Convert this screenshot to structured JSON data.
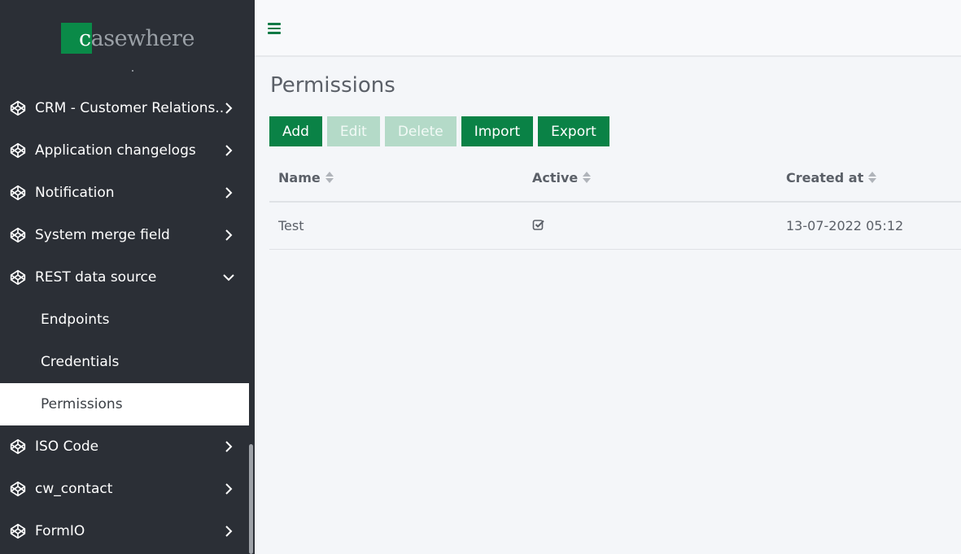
{
  "app": {
    "logo_text_c": "c",
    "logo_text_rest": "asewhere"
  },
  "sidebar": {
    "items": [
      {
        "label": "CRM - Customer Relations...",
        "icon": "codepen-icon",
        "chevron": "chevron-right"
      },
      {
        "label": "Application changelogs",
        "icon": "codepen-icon",
        "chevron": "chevron-right"
      },
      {
        "label": "Notification",
        "icon": "codepen-icon",
        "chevron": "chevron-right"
      },
      {
        "label": "System merge field",
        "icon": "codepen-icon",
        "chevron": "chevron-right"
      },
      {
        "label": "REST data source",
        "icon": "codepen-icon",
        "chevron": "chevron-down"
      },
      {
        "label": "ISO Code",
        "icon": "codepen-icon",
        "chevron": "chevron-right"
      },
      {
        "label": "cw_contact",
        "icon": "codepen-icon",
        "chevron": "chevron-right"
      },
      {
        "label": "FormIO",
        "icon": "codepen-icon",
        "chevron": "chevron-right"
      }
    ],
    "subitems": [
      {
        "label": "Endpoints"
      },
      {
        "label": "Credentials"
      },
      {
        "label": "Permissions",
        "active": true
      }
    ]
  },
  "header": {
    "menu_icon": "hamburger-icon"
  },
  "main": {
    "title": "Permissions",
    "toolbar": {
      "add": "Add",
      "edit": "Edit",
      "delete": "Delete",
      "import": "Import",
      "export": "Export"
    },
    "table": {
      "columns": [
        "Name",
        "Active",
        "Created at"
      ],
      "rows": [
        {
          "name": "Test",
          "active": true,
          "created_at": "13-07-2022 05:12"
        }
      ]
    }
  },
  "colors": {
    "accent": "#0a8246",
    "accent_disabled": "#b4dac8",
    "sidebar_bg": "#2b2f36"
  }
}
